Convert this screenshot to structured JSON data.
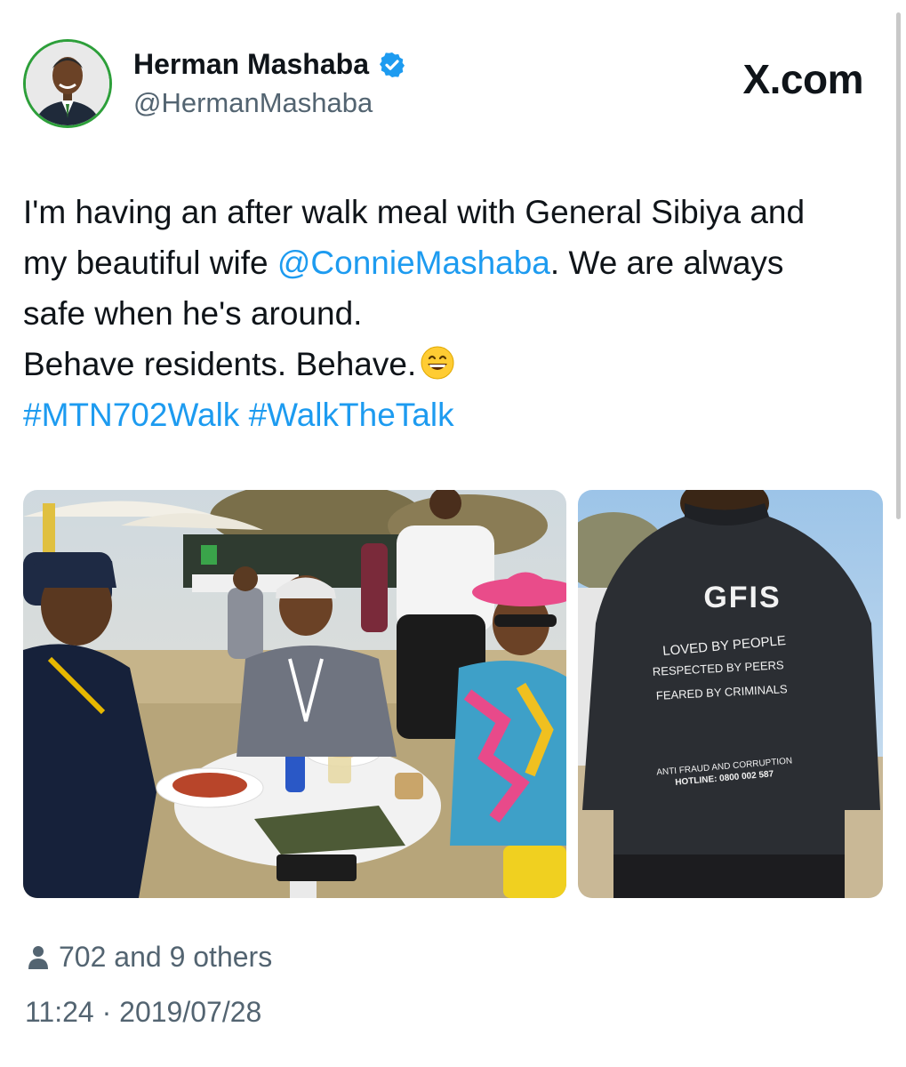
{
  "header": {
    "display_name": "Herman Mashaba",
    "handle": "@HermanMashaba",
    "brand": "X.com",
    "verified": true
  },
  "tweet": {
    "line1": "I'm having an after walk meal with General Sibiya and",
    "line2_prefix": "my beautiful wife ",
    "mention": "@ConnieMashaba",
    "line2_suffix": ". We are always",
    "line3": "safe when he's around.",
    "line4": "Behave residents. Behave.",
    "emoji": "grinning-face-emoji",
    "hashtag1": "#MTN702Walk",
    "hashtag2": "#WalkTheTalk"
  },
  "photos": {
    "right": {
      "jacket_title": "GFIS",
      "line1": "LOVED BY PEOPLE",
      "line2": "RESPECTED BY PEERS",
      "line3": "FEARED BY CRIMINALS",
      "hotline_title": "ANTI FRAUD AND CORRUPTION",
      "hotline": "HOTLINE: 0800 002 587"
    }
  },
  "footer": {
    "likes": "702 and 9 others",
    "timestamp": "11:24 · 2019/07/28"
  },
  "colors": {
    "link": "#1d9bf0",
    "secondary_text": "#536471",
    "verified_badge": "#1d9bf0"
  }
}
